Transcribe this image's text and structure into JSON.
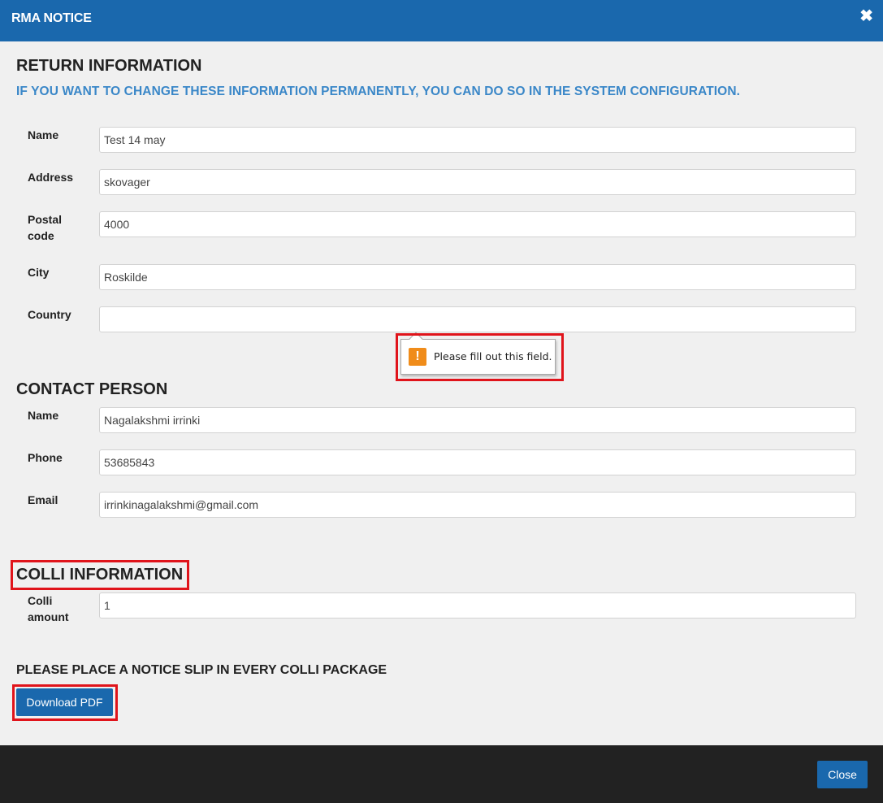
{
  "header": {
    "title": "RMA NOTICE",
    "close_glyph": "✖"
  },
  "return_info": {
    "title": "RETURN INFORMATION",
    "subtitle": "IF YOU WANT TO CHANGE THESE INFORMATION PERMANENTLY, YOU CAN DO SO IN THE SYSTEM CONFIGURATION.",
    "name_label": "Name",
    "name_value": "Test 14 may",
    "address_label": "Address",
    "address_value": "skovager",
    "postal_label_1": "Postal",
    "postal_label_2": "code",
    "postal_value": "4000",
    "city_label": "City",
    "city_value": "Roskilde",
    "country_label": "Country",
    "country_value": ""
  },
  "validation": {
    "message": "Please fill out this field.",
    "icon_glyph": "!"
  },
  "contact_person": {
    "title": "CONTACT PERSON",
    "name_label": "Name",
    "name_value": "Nagalakshmi irrinki",
    "phone_label": "Phone",
    "phone_value": "53685843",
    "email_label": "Email",
    "email_value": "irrinkinagalakshmi@gmail.com"
  },
  "colli": {
    "title": "COLLI INFORMATION",
    "amount_label_1": "Colli",
    "amount_label_2": "amount",
    "amount_value": "1"
  },
  "notice_text": "PLEASE PLACE A NOTICE SLIP IN EVERY COLLI PACKAGE",
  "download_label": "Download PDF",
  "footer": {
    "close_label": "Close"
  },
  "colors": {
    "header": "#1a68ad",
    "subtitle": "#3a87c8",
    "highlight": "#e0141b",
    "warning": "#f08c1a",
    "footer": "#222222"
  },
  "icons": {
    "close": "close-icon",
    "warning": "warning-icon"
  }
}
